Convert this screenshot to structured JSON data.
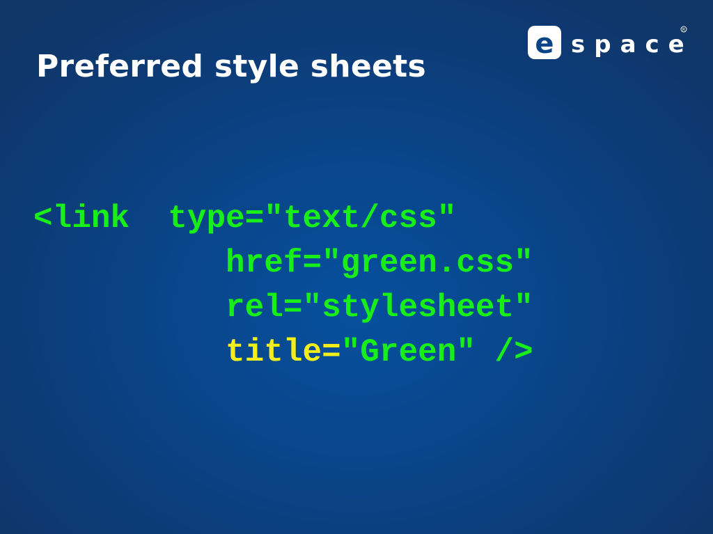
{
  "slide": {
    "title": "Preferred style sheets"
  },
  "logo": {
    "text": "espace",
    "registered": "®"
  },
  "code": {
    "lines": [
      {
        "indent": "",
        "attr": "<link  type",
        "value": "=\"text/css\""
      },
      {
        "indent": "          ",
        "attr": "href",
        "value": "=\"green.css\""
      },
      {
        "indent": "          ",
        "attr": "rel",
        "value": "=\"stylesheet\""
      },
      {
        "indent": "          ",
        "attr": "title=",
        "value": "\"Green\" />"
      }
    ],
    "colors": {
      "code": "#18ee18",
      "highlight": "#f2ee1a"
    }
  },
  "colors": {
    "background": "#0a4386",
    "title": "#ffffff"
  }
}
